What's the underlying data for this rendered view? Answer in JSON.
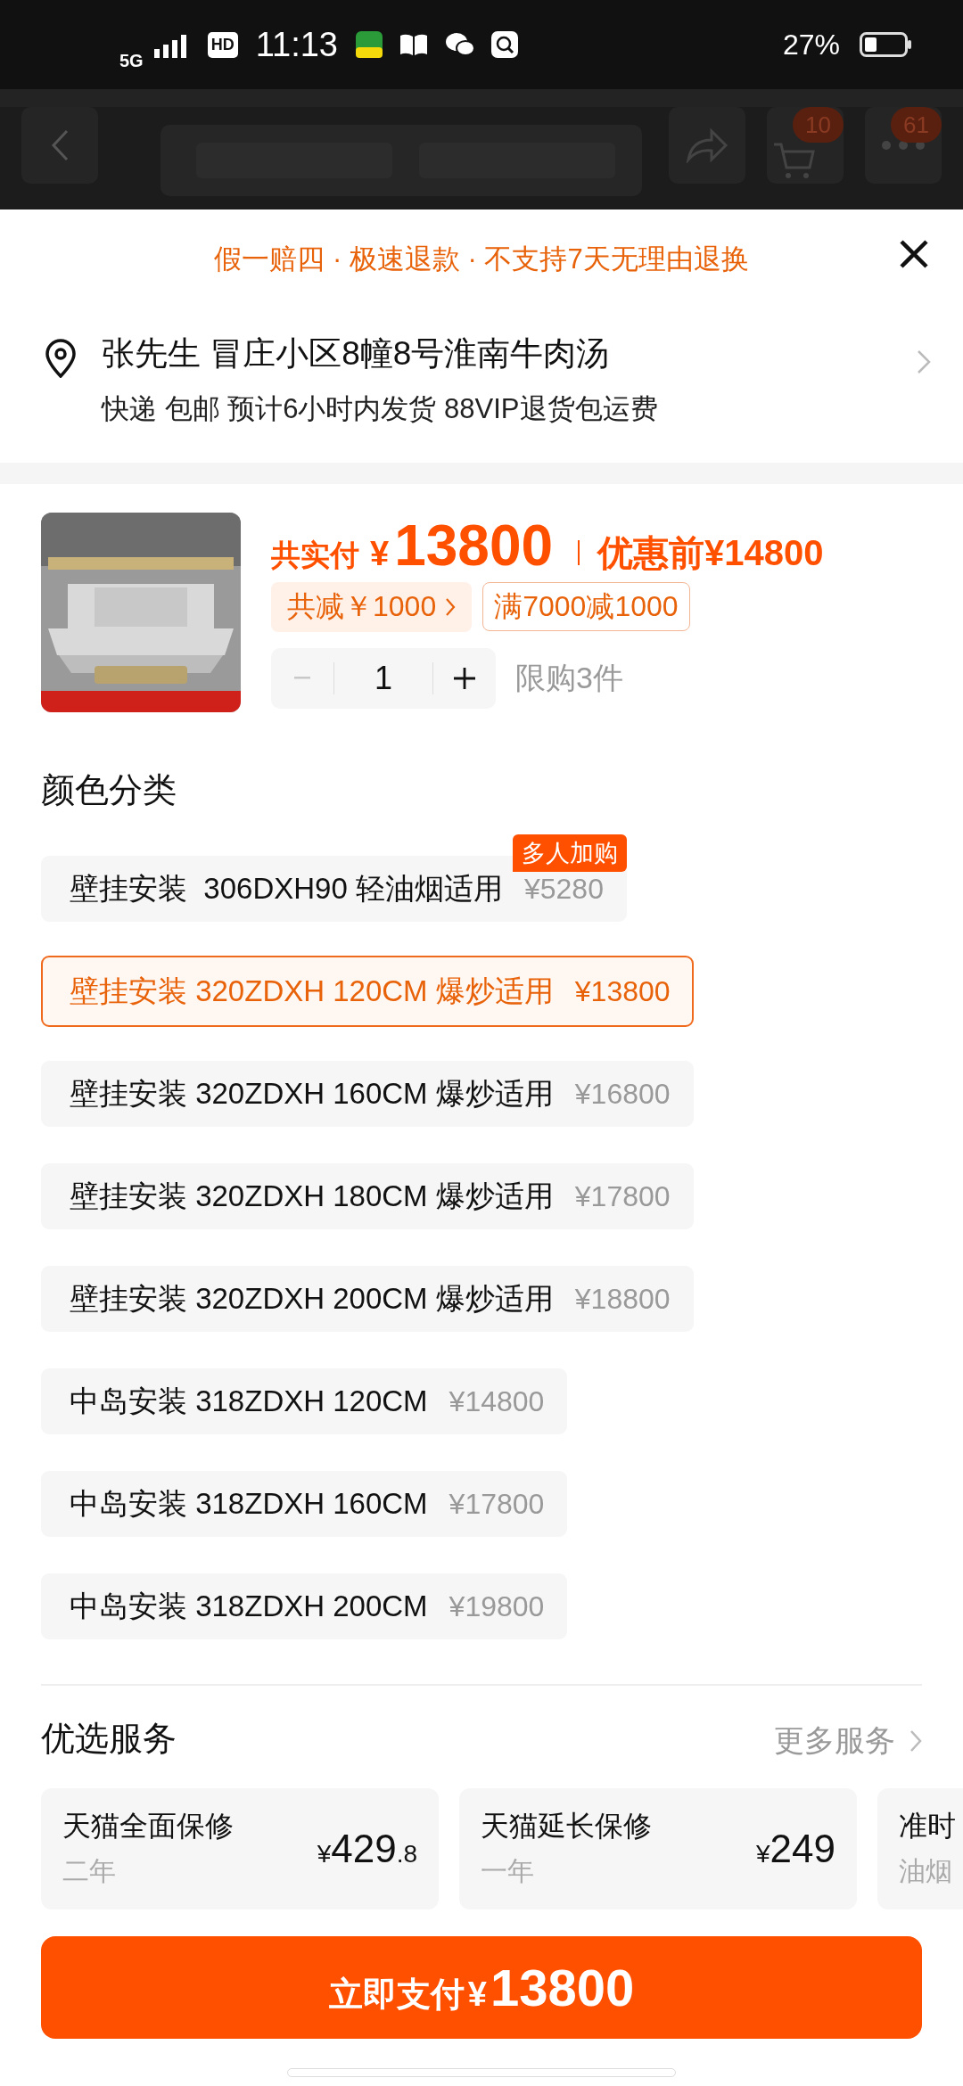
{
  "status_bar": {
    "network": "5G",
    "hd": "HD",
    "time": "11:13",
    "battery": "27%"
  },
  "header": {
    "cart_count": "10",
    "more_count": "61"
  },
  "sheet": {
    "notice": "假一赔四 · 极速退款 · 不支持7天无理由退换",
    "address": {
      "line": "张先生 冒庄小区8幢8号淮南牛肉汤",
      "delivery": "快递 包邮 预计6小时内发货 88VIP退货包运费"
    },
    "product": {
      "price_label": "共实付",
      "currency": "¥",
      "price": "13800",
      "original_price": "优惠前¥14800",
      "discount": "共减￥1000",
      "promo": "满7000减1000",
      "quantity": {
        "value": "1",
        "minus_disabled": true
      },
      "limit": "限购3件"
    },
    "options_title": "颜色分类",
    "options": [
      {
        "label": "壁挂安装  306DXH90 轻油烟适用",
        "price": "¥5280",
        "selected": false,
        "badge": "多人加购"
      },
      {
        "label": "壁挂安装 320ZDXH 120CM 爆炒适用",
        "price": "¥13800",
        "selected": true
      },
      {
        "label": "壁挂安装 320ZDXH 160CM 爆炒适用",
        "price": "¥16800",
        "selected": false
      },
      {
        "label": "壁挂安装 320ZDXH 180CM 爆炒适用",
        "price": "¥17800",
        "selected": false
      },
      {
        "label": "壁挂安装 320ZDXH 200CM 爆炒适用",
        "price": "¥18800",
        "selected": false
      },
      {
        "label": "中岛安装 318ZDXH 120CM",
        "price": "¥14800",
        "selected": false
      },
      {
        "label": "中岛安装 318ZDXH 160CM",
        "price": "¥17800",
        "selected": false
      },
      {
        "label": "中岛安装 318ZDXH 200CM",
        "price": "¥19800",
        "selected": false
      }
    ],
    "services_title": "优选服务",
    "more_services": "更多服务",
    "services": [
      {
        "title": "天猫全面保修",
        "term": "二年",
        "currency": "¥",
        "amount": "429",
        "decimal": ".8"
      },
      {
        "title": "天猫延长保修",
        "term": "一年",
        "currency": "¥",
        "amount": "249"
      },
      {
        "title": "准时",
        "term": "油烟"
      }
    ],
    "pay_button": {
      "label": "立即支付",
      "currency": "¥",
      "amount": "13800"
    }
  }
}
